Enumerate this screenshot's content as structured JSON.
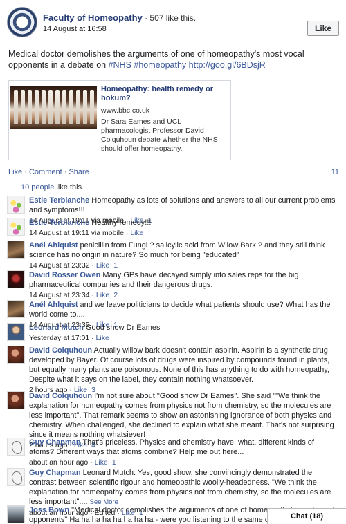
{
  "post": {
    "page_name": "Faculty of Homeopathy",
    "page_likes": " · 507 like this.",
    "timestamp": "14 August at 16:58",
    "like_button": "Like",
    "text_plain": "Medical doctor demolishes the arguments of one of homeopathy's most vocal opponents in a debate on ",
    "hashtag_nhs": "#NHS",
    "hashtag_homeopathy": "#homeopathy",
    "short_link": "http://goo.gl/6BDsjR"
  },
  "share": {
    "title": "Homeopathy: health remedy or hokum?",
    "domain": "www.bbc.co.uk",
    "description": "Dr Sara Eames and UCL pharmacologist Professor David Colquhoun debate whether the NHS should offer homeopathy."
  },
  "actions": {
    "like": "Like",
    "comment": "Comment",
    "share": "Share",
    "share_count": "11"
  },
  "likes": {
    "count_link": "10 people",
    "suffix": " like this."
  },
  "comments": [
    {
      "author": "Estie Terblanche",
      "text": " Homeopathy as lots of solutions and answers to all our current problems and symptoms!!!",
      "time": "14 August at 19:11 via mobile",
      "like": "Like",
      "count": "1"
    },
    {
      "author": "Estie Terblanche",
      "text": " Healthy remedy!!!",
      "time": "14 August at 19:11 via mobile",
      "like": "Like",
      "count": ""
    },
    {
      "author": "Anél Ahlquist",
      "text": " penicillin from Fungi ? salicylic acid from Wilow Bark ? and they still think science has no origin in nature? So much for being \"educated\"",
      "time": "14 August at 23:32",
      "like": "Like",
      "count": "1"
    },
    {
      "author": "David Rosser Owen",
      "text": " Many GPs have decayed simply into sales reps for the big pharmaceutical companies and their dangerous drugs.",
      "time": "14 August at 23:34",
      "like": "Like",
      "count": "2"
    },
    {
      "author": "Anél Ahlquist",
      "text": " and we leave politicians to decide what patients should use? What has the world come to....",
      "time": "14 August at 23:35",
      "like": "Like",
      "count": "1"
    },
    {
      "author": "Leonard Mutch",
      "text": " Good show Dr Eames",
      "time": "Yesterday at 17:01",
      "like": "Like",
      "count": ""
    },
    {
      "author": "David Colquhoun",
      "text": " Actually willow bark doesn't contain aspirin. Aspirin is a synthetic drug developed by Bayer. Of course lots of drugs were inspired by compounds found in plants, but equally many plants are poisonous. None of this has anything to do with homeopathy, Despite what it says on the label, they contain nothing whatsoever.",
      "time": "2 hours ago",
      "like": "Like",
      "count": "3"
    },
    {
      "author": "David Colquhoun",
      "text": " I'm not sure about \"Good show Dr Eames\". She said \"\"We think the explanation for homeopathy comes from physics not from chemistry, so the molecules are less important\". That remark seems to show an astonishing ignorance of both physics and chemistry. When challenged, she declined to explain what she meant. That's not surprising since it means nothing whatsiever!",
      "time": "2 hours ago",
      "like": "Like",
      "count": "4"
    },
    {
      "author": "Guy Chapman",
      "text": " That's priceless. Physics and chemistry have, what, different kinds of atoms? Different ways that atoms combine? Help me out here...",
      "time": "about an hour ago",
      "like": "Like",
      "count": "1"
    },
    {
      "author": "Guy Chapman",
      "text": " Leonard Mutch: Yes, good show, she convincingly demonstrated the contrast between scientific rigour and homeopathic woolly-headedness. \"We think the explanation for homeopathy comes from physics not from chemistry, so the molecules are less important\"....",
      "see_more": "See More",
      "time": "about an hour ago",
      "edited": "Edited",
      "like": "Like",
      "count": "1"
    },
    {
      "author": "Joss Bown",
      "text": " \"Medical doctor demolishes the arguments of one of homeopathy's most vocal opponents\" Ha ha ha ha ha ha ha ha - were you listening to the same debate? Ha ha ha ha ha ha ha Deluded",
      "time": "",
      "like": "",
      "count": ""
    }
  ],
  "chat": {
    "label": "Chat (18)"
  }
}
